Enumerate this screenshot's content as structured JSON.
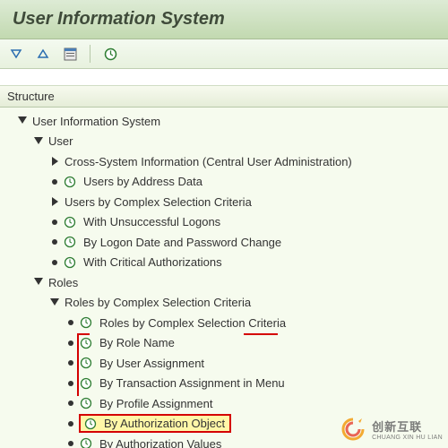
{
  "title": "User Information System",
  "structure_header": "Structure",
  "tree": {
    "root": "User Information System",
    "user": {
      "label": "User",
      "items": [
        "Cross-System Information (Central User Administration)",
        "Users by Address Data",
        "Users by Complex Selection Criteria",
        "With Unsuccessful Logons",
        "By Logon Date and Password Change",
        "With Critical Authorizations"
      ]
    },
    "roles": {
      "label": "Roles",
      "sub": "Roles by Complex Selection Criteria",
      "items": [
        "Roles by Complex Selection Criteria",
        "By Role Name",
        "By User Assignment",
        "By Transaction Assignment in Menu",
        "By Profile Assignment",
        "By Authorization Object",
        "By Authorization Values"
      ]
    }
  },
  "watermark": {
    "line1": "创新互联",
    "line2": "CHUANG XIN HU LIAN"
  }
}
